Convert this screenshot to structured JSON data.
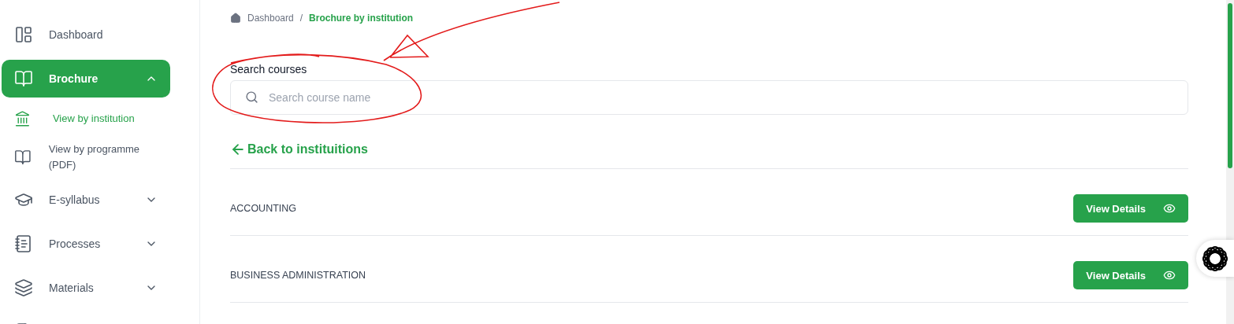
{
  "sidebar": {
    "items": [
      {
        "label": "Dashboard",
        "selected": false
      },
      {
        "label": "Brochure",
        "selected": true,
        "expanded": true,
        "children": [
          {
            "label": "View by institution",
            "selected": true
          },
          {
            "label": "View by programme (PDF)",
            "selected": false
          }
        ]
      },
      {
        "label": "E-syllabus",
        "selected": false,
        "expanded": false
      },
      {
        "label": "Processes",
        "selected": false,
        "expanded": false
      },
      {
        "label": "Materials",
        "selected": false,
        "expanded": false
      },
      {
        "selected": false
      }
    ]
  },
  "breadcrumb_separator": "/",
  "breadcrumb": [
    {
      "label": "Dashboard",
      "current": false
    },
    {
      "label": "Brochure by institution",
      "current": true
    }
  ],
  "search": {
    "label": "Search courses",
    "placeholder": "Search course name"
  },
  "back_link": "Back to instituitions",
  "courses": [
    {
      "name": "ACCOUNTING",
      "button": "View Details"
    },
    {
      "name": "BUSINESS ADMINISTRATION",
      "button": "View Details"
    }
  ]
}
